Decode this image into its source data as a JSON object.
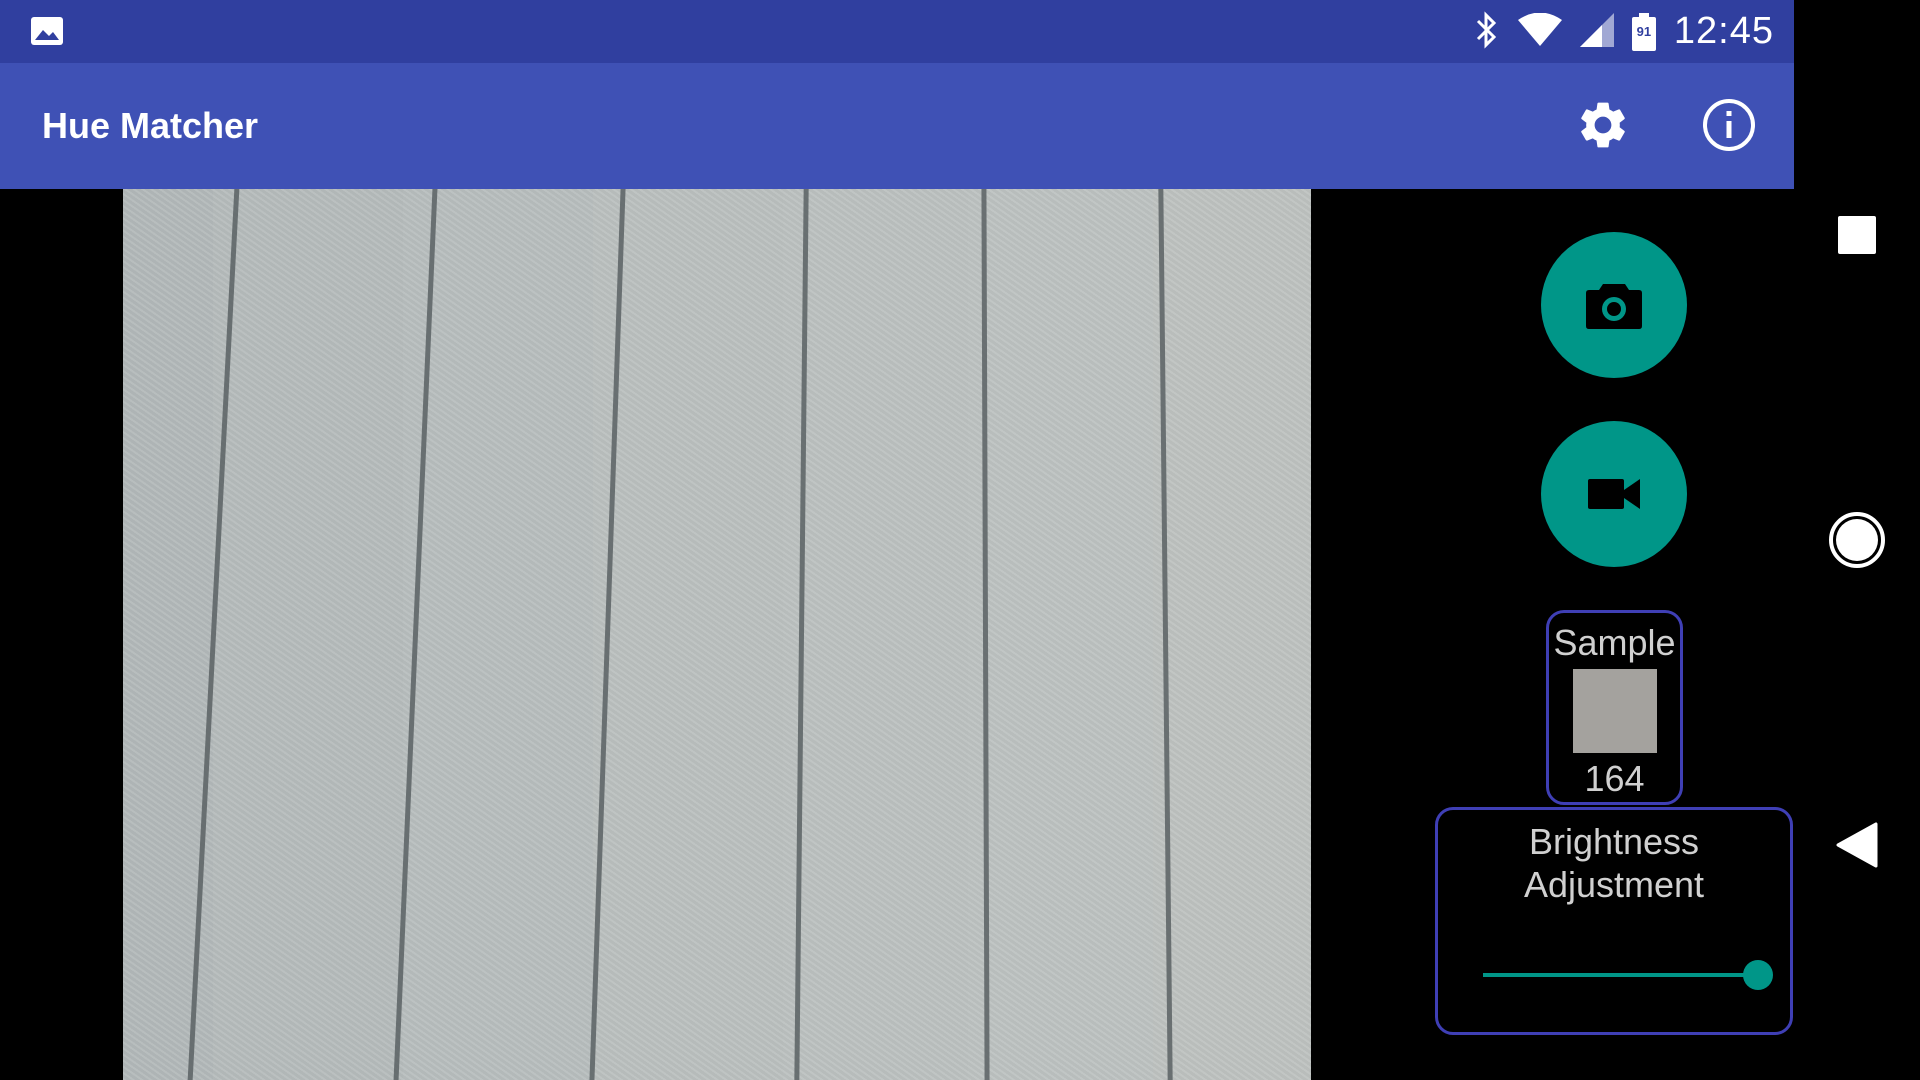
{
  "status_bar": {
    "time": "12:45",
    "battery_level": "91",
    "icons": [
      "image-icon",
      "bluetooth-icon",
      "wifi-icon",
      "signal-icon",
      "battery-icon"
    ]
  },
  "app_bar": {
    "title": "Hue Matcher",
    "actions": [
      "settings-icon",
      "info-icon"
    ],
    "color": "#3f51b5",
    "status_color": "#303f9f"
  },
  "controls": {
    "photo_button_icon": "camera-icon",
    "video_button_icon": "videocam-icon",
    "accent_color": "#009688",
    "sample": {
      "label": "Sample",
      "value": "164",
      "swatch_color": "#a4a29e"
    },
    "brightness": {
      "label_line1": "Brightness",
      "label_line2": "Adjustment",
      "slider_value": 1.0
    }
  },
  "nav_bar": {
    "buttons": [
      "recents-icon",
      "home-icon",
      "back-icon"
    ]
  }
}
